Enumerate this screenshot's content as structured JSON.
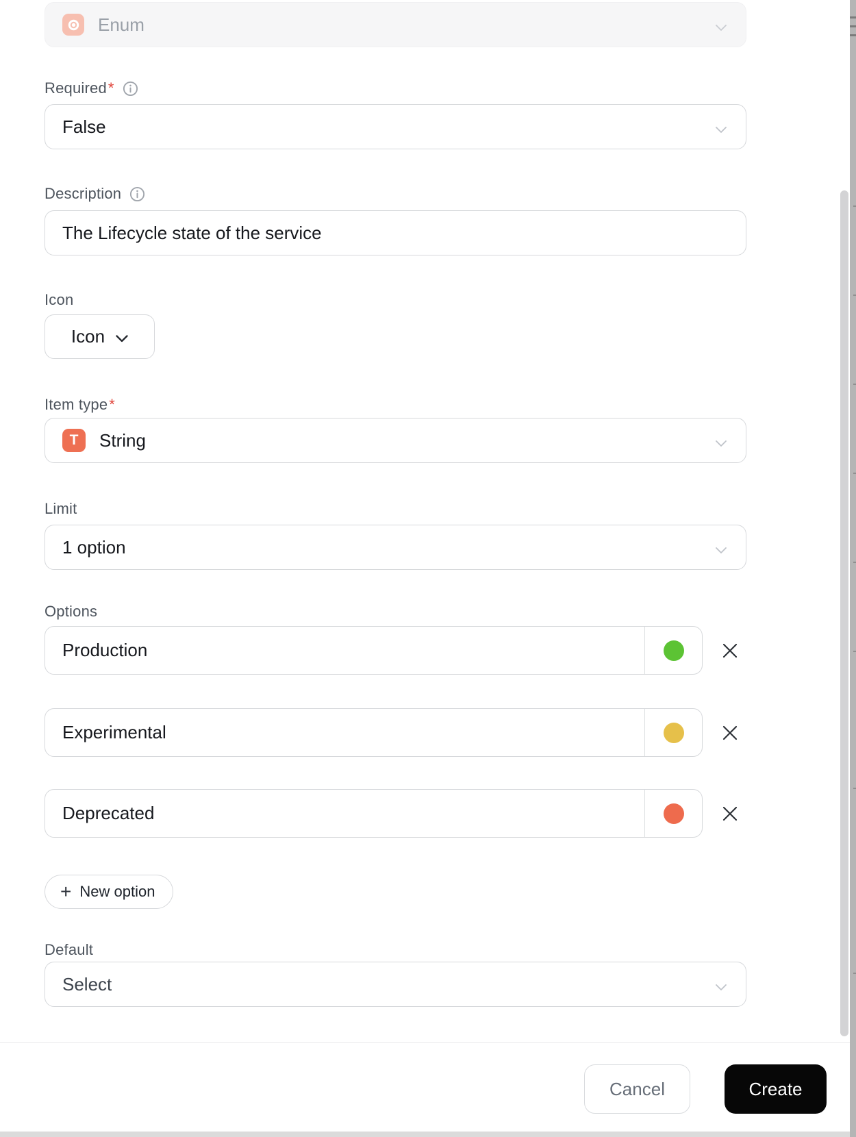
{
  "dialog": {
    "type_select": {
      "value": "Enum"
    },
    "required_field": {
      "label": "Required",
      "asterisk": "*",
      "value": "False"
    },
    "description_field": {
      "label": "Description",
      "value": "The Lifecycle state of the service"
    },
    "icon_field": {
      "label": "Icon",
      "button_label": "Icon"
    },
    "item_type_field": {
      "label": "Item type",
      "asterisk": "*",
      "value": "String",
      "icon_letter": "T"
    },
    "limit_field": {
      "label": "Limit",
      "value": "1 option"
    },
    "options_field": {
      "label": "Options",
      "options": [
        {
          "value": "Production",
          "color": "#5cc334"
        },
        {
          "value": "Experimental",
          "color": "#e6c04a"
        },
        {
          "value": "Deprecated",
          "color": "#ee6b4d"
        }
      ]
    },
    "new_option_button": {
      "label": "New option"
    },
    "default_field": {
      "label": "Default",
      "placeholder": "Select"
    },
    "footer": {
      "cancel_label": "Cancel",
      "create_label": "Create"
    },
    "colors": {
      "enum_icon_bg": "#f7bfb0",
      "string_icon_bg": "#ee7053",
      "create_button_bg": "#070707"
    }
  }
}
